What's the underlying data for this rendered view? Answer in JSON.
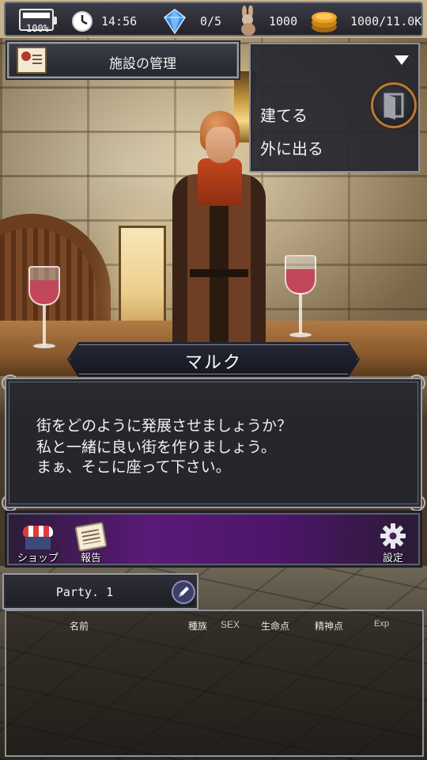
{
  "status_bar": {
    "battery": "100%",
    "time": "14:56",
    "gems": "0/5",
    "rabbit_count": "1000",
    "gold": "1000/11.0K"
  },
  "facility": {
    "title": "施設の管理"
  },
  "menu": {
    "items": [
      "建てる",
      "外に出る"
    ]
  },
  "dialogue": {
    "speaker": "マルク",
    "lines": [
      "街をどのように発展させましょうか？",
      "私と一緒に良い街を作りましょう。",
      "まぁ、そこに座って下さい。"
    ]
  },
  "actions": {
    "shop": "ショップ",
    "report": "報告",
    "settings": "設定"
  },
  "party": {
    "name": "Party. 1",
    "columns": [
      "名前",
      "種族",
      "SEX",
      "生命点",
      "精神点",
      "Exp"
    ]
  }
}
